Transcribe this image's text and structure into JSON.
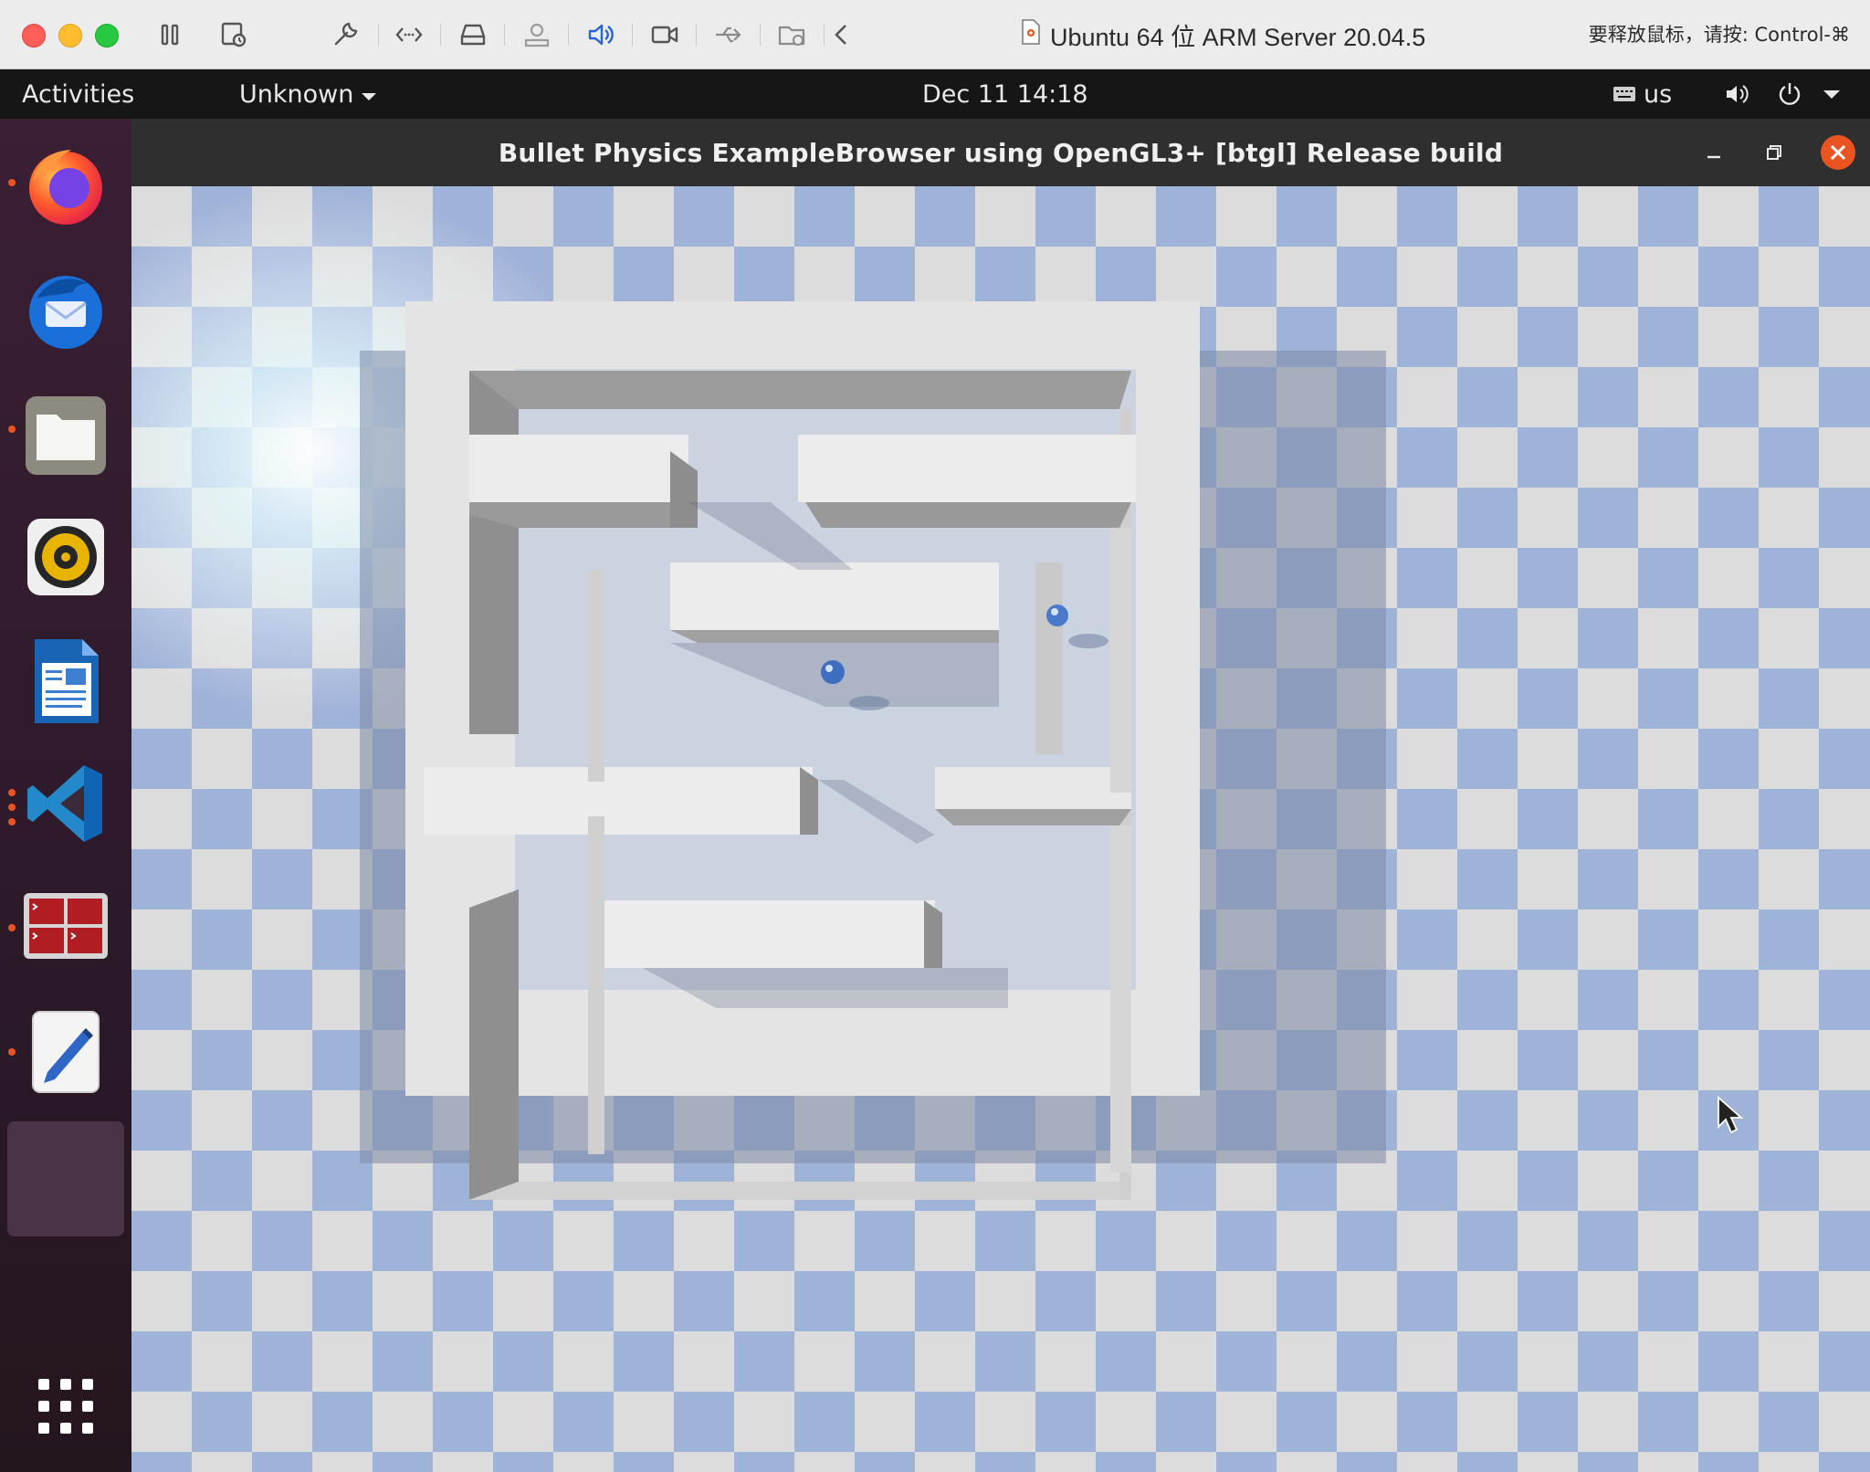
{
  "vm_toolbar": {
    "title": "Ubuntu 64 位 ARM Server 20.04.5",
    "release_hint": "要释放鼠标，请按: Control-⌘",
    "icons": [
      "pause-icon",
      "snapshot-icon",
      "settings-wrench-icon",
      "code-brackets-icon",
      "disk-icon",
      "printer-icon",
      "speaker-icon",
      "camera-icon",
      "usb-icon",
      "shared-folder-icon",
      "back-chevron-icon"
    ]
  },
  "gnome_bar": {
    "activities": "Activities",
    "app_menu": "Unknown",
    "clock": "Dec 11  14:18",
    "keyboard_layout": "us"
  },
  "dock": {
    "apps": [
      "firefox",
      "thunderbird",
      "files",
      "rhythmbox",
      "libreoffice-writer",
      "visual-studio-code",
      "terminal-app",
      "text-editor",
      "running-app",
      "show-applications"
    ]
  },
  "app_window": {
    "title": "Bullet Physics ExampleBrowser using OpenGL3+ [btgl] Release build"
  },
  "colors": {
    "ubuntu_orange": "#e95420",
    "checker_blue": "#9fb2d8",
    "checker_light": "#dcdcdc"
  }
}
